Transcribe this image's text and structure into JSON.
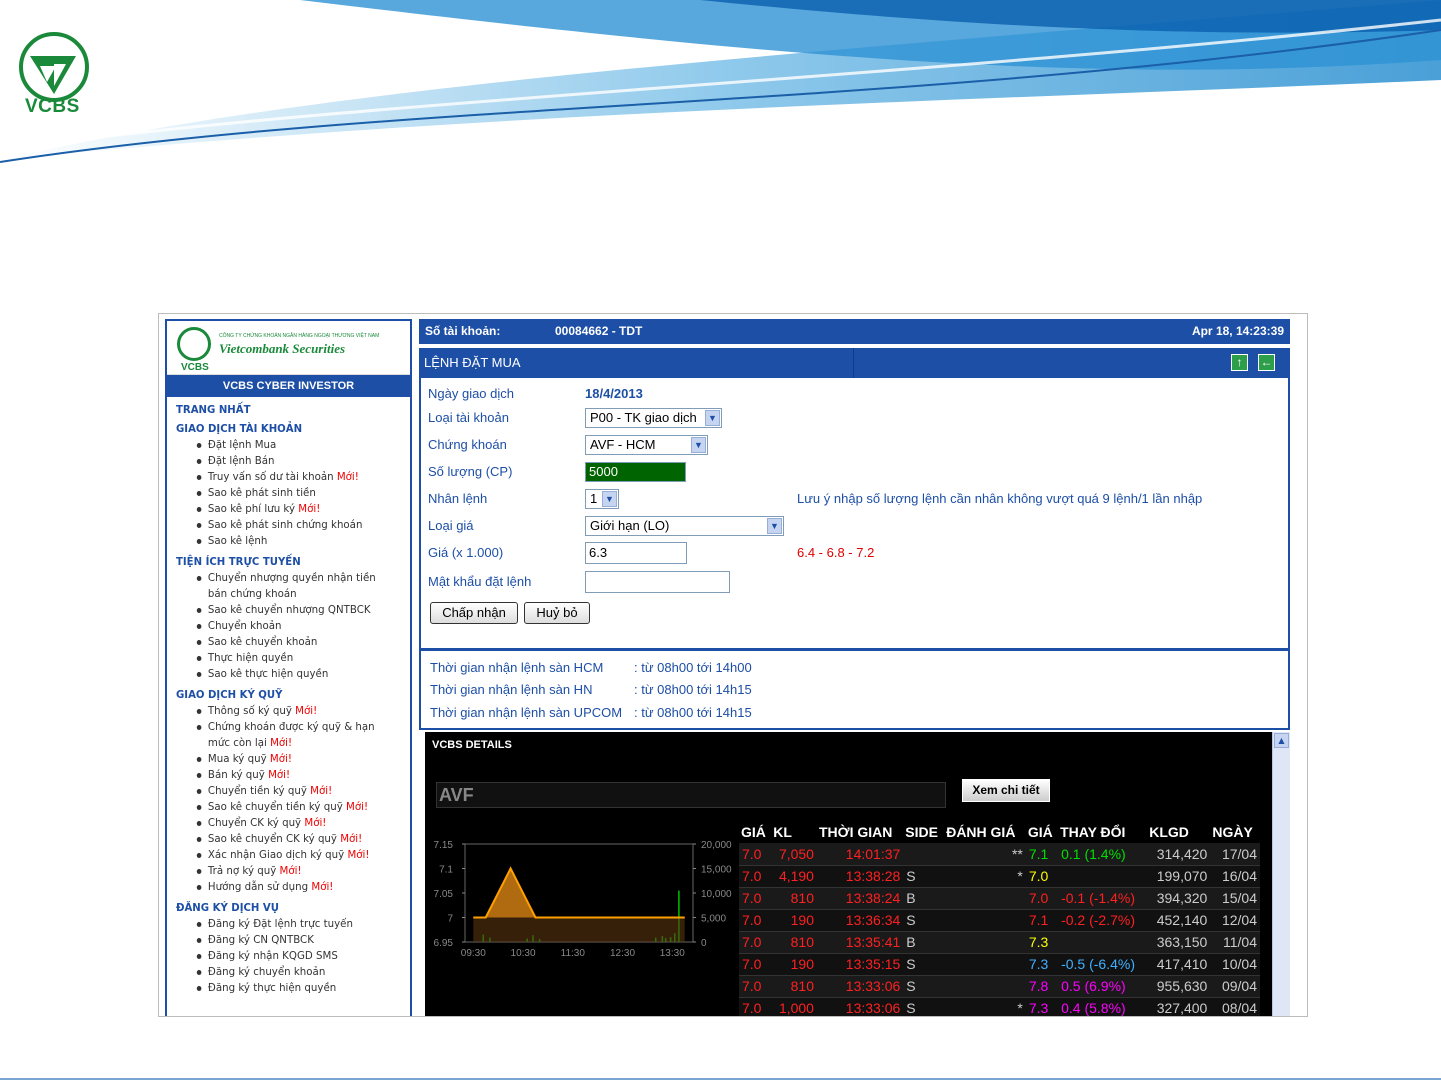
{
  "brand": {
    "logo_text": "VCBS",
    "company_line": "CÔNG TY CHỨNG KHOÁN NGÂN HÀNG NGOẠI THƯƠNG VIỆT NAM",
    "company_name": "Vietcombank Securities",
    "logo_short": "VCBS"
  },
  "nav": {
    "title": "VCBS CYBER INVESTOR",
    "sections": [
      {
        "label": "TRANG NHẤT",
        "items": []
      },
      {
        "label": "GIAO DỊCH TÀI KHOẢN",
        "items": [
          {
            "label": "Đặt lệnh Mua",
            "new": ""
          },
          {
            "label": "Đặt lệnh Bán",
            "new": ""
          },
          {
            "label": "Truy vấn số dư tài khoản ",
            "new": "Mới!"
          },
          {
            "label": "Sao kê phát sinh tiền",
            "new": ""
          },
          {
            "label": "Sao kê phí lưu ký ",
            "new": "Mới!"
          },
          {
            "label": "Sao kê phát sinh chứng khoán",
            "new": ""
          },
          {
            "label": "Sao kê lệnh",
            "new": ""
          }
        ]
      },
      {
        "label": "TIỆN ÍCH TRỰC TUYẾN",
        "items": [
          {
            "label": "Chuyển nhượng quyền nhận tiền bán chứng khoán",
            "new": ""
          },
          {
            "label": "Sao kê chuyển nhượng QNTBCK",
            "new": ""
          },
          {
            "label": "Chuyển khoản",
            "new": ""
          },
          {
            "label": "Sao kê chuyển khoản",
            "new": ""
          },
          {
            "label": "Thực hiện quyền",
            "new": ""
          },
          {
            "label": "Sao kê thực hiện quyền",
            "new": ""
          }
        ]
      },
      {
        "label": "GIAO DỊCH KÝ QUỸ",
        "items": [
          {
            "label": "Thông số ký quỹ ",
            "new": "Mới!"
          },
          {
            "label": "Chứng khoán được ký quỹ & hạn mức còn lại ",
            "new": "Mới!"
          },
          {
            "label": "Mua ký quỹ ",
            "new": "Mới!"
          },
          {
            "label": "Bán ký quỹ ",
            "new": "Mới!"
          },
          {
            "label": "Chuyển tiền ký quỹ ",
            "new": "Mới!"
          },
          {
            "label": "Sao kê chuyển tiền ký quỹ ",
            "new": "Mới!"
          },
          {
            "label": "Chuyển CK ký quỹ ",
            "new": "Mới!"
          },
          {
            "label": "Sao kê chuyển CK ký quỹ ",
            "new": "Mới!"
          },
          {
            "label": "Xác nhận Giao dịch ký quỹ ",
            "new": "Mới!"
          },
          {
            "label": "Trả nợ ký quỹ ",
            "new": "Mới!"
          },
          {
            "label": "Hướng dẫn sử dụng ",
            "new": "Mới!"
          }
        ]
      },
      {
        "label": "ĐĂNG KÝ DỊCH VỤ",
        "items": [
          {
            "label": "Đăng ký Đặt lệnh trực tuyến",
            "new": ""
          },
          {
            "label": "Đăng ký CN QNTBCK",
            "new": ""
          },
          {
            "label": "Đăng ký nhận KQGD SMS",
            "new": ""
          },
          {
            "label": "Đăng ký chuyển khoản",
            "new": ""
          },
          {
            "label": "Đăng ký thực hiện quyền",
            "new": ""
          }
        ]
      }
    ]
  },
  "account": {
    "label": "Số tài khoản:",
    "value": "00084662 - TDT",
    "datetime": "Apr 18, 14:23:39"
  },
  "form": {
    "title": "LỆNH ĐẶT MUA",
    "trade_date_label": "Ngày giao dịch",
    "trade_date": "18/4/2013",
    "acct_type_label": "Loại tài khoản",
    "acct_type": "P00 - TK giao dịch",
    "symbol_label": "Chứng khoán",
    "symbol": "AVF - HCM",
    "qty_label": "Số lượng (CP)",
    "qty": "5000",
    "multiply_label": "Nhân lệnh",
    "multiply": "1",
    "multiply_note": "Lưu ý nhập số lượng lệnh cần nhân không vượt quá 9 lệnh/1 lần nhập",
    "price_type_label": "Loại giá",
    "price_type": "Giới hạn (LO)",
    "price_label": "Giá (x 1.000)",
    "price": "6.3",
    "price_range": "6.4 - 6.8 - 7.2",
    "password_label": "Mật khẩu đặt lệnh",
    "password": "",
    "submit": "Chấp nhận",
    "cancel": "Huỷ bỏ"
  },
  "hours": [
    {
      "label": "Thời gian nhận lệnh sàn HCM",
      "value": ": từ 08h00 tới 14h00"
    },
    {
      "label": "Thời gian nhận lệnh sàn HN",
      "value": ": từ 08h00 tới 14h15"
    },
    {
      "label": "Thời gian nhận lệnh sàn UPCOM",
      "value": ": từ 08h00 tới 14h15"
    }
  ],
  "details": {
    "title": "VCBS DETAILS",
    "symbol": "AVF",
    "detail_button": "Xem chi tiết"
  },
  "colors": {
    "nav_blue": "#1d4fa6",
    "brand_green": "#1a8a3a",
    "new_red": "#e00000",
    "qty_bg": "#006400"
  },
  "chart_data": {
    "type": "line",
    "x_ticks": [
      "09:30",
      "10:30",
      "11:30",
      "12:30",
      "13:30"
    ],
    "y_ticks": [
      "7.15",
      "7.1",
      "7.05",
      "7",
      "6.95"
    ],
    "y2_ticks": [
      "20,000",
      "15,000",
      "10,000",
      "5,000",
      "0"
    ],
    "ylim": [
      6.95,
      7.15
    ],
    "y2lim": [
      0,
      20000
    ],
    "price_series": {
      "x": [
        "09:30",
        "09:45",
        "10:15",
        "10:45",
        "13:45"
      ],
      "values": [
        7.0,
        7.0,
        7.1,
        7.0,
        7.0
      ]
    },
    "volume_series": {
      "x": [
        "09:42",
        "09:50",
        "10:35",
        "10:42",
        "10:50",
        "13:10",
        "13:18",
        "13:22",
        "13:28",
        "13:33",
        "13:38"
      ],
      "values": [
        1500,
        900,
        700,
        1400,
        600,
        900,
        1200,
        800,
        1000,
        1800,
        10500
      ]
    }
  },
  "table": {
    "headers": [
      "GIÁ",
      "KL",
      "THỜI GIAN",
      "SIDE",
      "ĐÁNH GIÁ",
      "GIÁ",
      "THAY ĐỔI",
      "KLGD",
      "NGÀY"
    ],
    "rows": [
      {
        "gia": "7.0",
        "kl": "7,050",
        "tg": "14:01:37",
        "side": "",
        "dg": "**",
        "gia2": "7.1",
        "td": "0.1 (1.4%)",
        "klgd": "314,420",
        "ngay": "17/04",
        "c2": "#00e000"
      },
      {
        "gia": "7.0",
        "kl": "4,190",
        "tg": "13:38:28",
        "side": "S",
        "dg": "*",
        "gia2": "7.0",
        "td": "",
        "klgd": "199,070",
        "ngay": "16/04",
        "c2": "#ffff00"
      },
      {
        "gia": "7.0",
        "kl": "810",
        "tg": "13:38:24",
        "side": "B",
        "dg": "",
        "gia2": "7.0",
        "td": "-0.1 (-1.4%)",
        "klgd": "394,320",
        "ngay": "15/04",
        "c2": "#ff2020"
      },
      {
        "gia": "7.0",
        "kl": "190",
        "tg": "13:36:34",
        "side": "S",
        "dg": "",
        "gia2": "7.1",
        "td": "-0.2 (-2.7%)",
        "klgd": "452,140",
        "ngay": "12/04",
        "c2": "#ff2020"
      },
      {
        "gia": "7.0",
        "kl": "810",
        "tg": "13:35:41",
        "side": "B",
        "dg": "",
        "gia2": "7.3",
        "td": "",
        "klgd": "363,150",
        "ngay": "11/04",
        "c2": "#ffff00"
      },
      {
        "gia": "7.0",
        "kl": "190",
        "tg": "13:35:15",
        "side": "S",
        "dg": "",
        "gia2": "7.3",
        "td": "-0.5 (-6.4%)",
        "klgd": "417,410",
        "ngay": "10/04",
        "c2": "#40b0ff"
      },
      {
        "gia": "7.0",
        "kl": "810",
        "tg": "13:33:06",
        "side": "S",
        "dg": "",
        "gia2": "7.8",
        "td": "0.5 (6.9%)",
        "klgd": "955,630",
        "ngay": "09/04",
        "c2": "#ff00ff"
      },
      {
        "gia": "7.0",
        "kl": "1,000",
        "tg": "13:33:06",
        "side": "S",
        "dg": "*",
        "gia2": "7.3",
        "td": "0.4 (5.8%)",
        "klgd": "327,400",
        "ngay": "08/04",
        "c2": "#ff00ff"
      }
    ]
  }
}
